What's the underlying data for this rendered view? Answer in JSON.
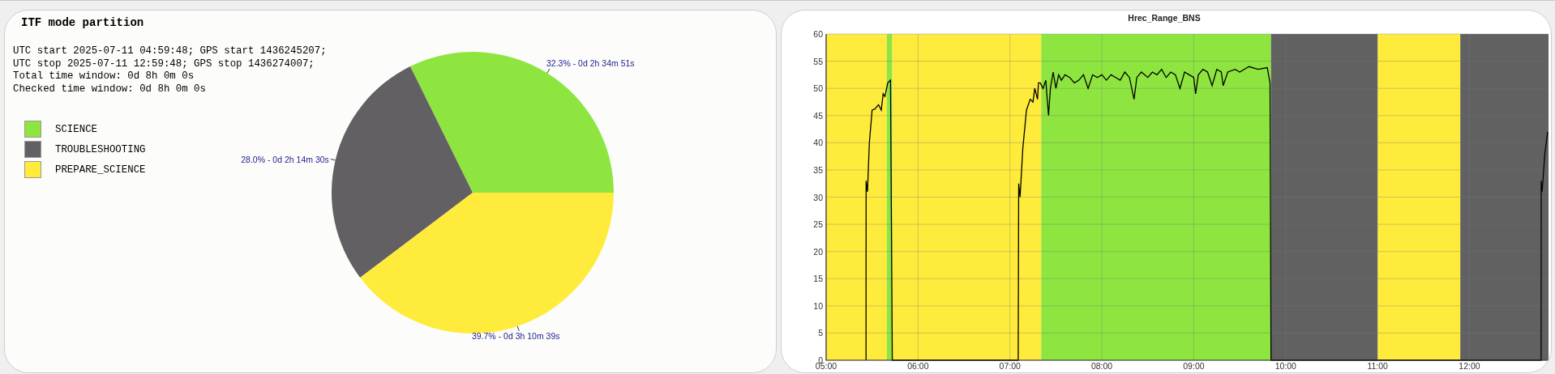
{
  "partition_panel": {
    "title": "ITF mode partition",
    "info_lines": [
      "UTC start 2025-07-11 04:59:48; GPS start 1436245207;",
      "UTC stop 2025-07-11 12:59:48; GPS stop 1436274007;",
      "Total time window: 0d 8h 0m 0s",
      "Checked time window: 0d 8h 0m 0s"
    ],
    "chart_data": {
      "type": "pie",
      "categories": [
        "SCIENCE",
        "TROUBLESHOOTING",
        "PREPARE_SCIENCE"
      ],
      "series": [
        {
          "values": [
            32.3,
            28.0,
            39.7
          ]
        }
      ],
      "colors": [
        "#8ee53f",
        "#636063",
        "#ffeb3b"
      ],
      "value_labels": [
        "32.3% - 0d 2h 34m 51s",
        "28.0% - 0d 2h 14m 30s",
        "39.7% - 0d 3h 10m 39s"
      ]
    }
  },
  "range_panel": {
    "chart_data": {
      "type": "line",
      "title": "Hrec_Range_BNS",
      "x": [
        5.434,
        5.435,
        5.45,
        5.47,
        5.5,
        5.53,
        5.57,
        5.6,
        5.62,
        5.64,
        5.67,
        5.7,
        5.72,
        5.722,
        7.09,
        7.095,
        7.11,
        7.14,
        7.18,
        7.22,
        7.25,
        7.27,
        7.3,
        7.31,
        7.33,
        7.36,
        7.39,
        7.42,
        7.44,
        7.47,
        7.5,
        7.53,
        7.56,
        7.6,
        7.65,
        7.7,
        7.75,
        7.8,
        7.85,
        7.9,
        7.95,
        8.0,
        8.05,
        8.1,
        8.15,
        8.2,
        8.25,
        8.3,
        8.35,
        8.38,
        8.43,
        8.5,
        8.55,
        8.6,
        8.65,
        8.7,
        8.75,
        8.8,
        8.85,
        8.9,
        8.95,
        9.0,
        9.02,
        9.05,
        9.1,
        9.15,
        9.2,
        9.25,
        9.3,
        9.32,
        9.37,
        9.45,
        9.5,
        9.6,
        9.7,
        9.8,
        9.83,
        9.84,
        12.78,
        12.781,
        12.79,
        12.82,
        12.85
      ],
      "series": [
        {
          "color": "#000000",
          "values": [
            0,
            33,
            31,
            40,
            46,
            46.2,
            47,
            46,
            49,
            48.5,
            51,
            51.5,
            0,
            0,
            0,
            32.5,
            30,
            39,
            46,
            48,
            47.5,
            50,
            48,
            51,
            51,
            50,
            51.5,
            45,
            50,
            53,
            50,
            52.5,
            51.5,
            52.5,
            52,
            51,
            51.5,
            52.5,
            50,
            52.5,
            52,
            52.5,
            51.5,
            52.5,
            52,
            51.5,
            53,
            52,
            48,
            52,
            53,
            52,
            53,
            52.5,
            53.5,
            52,
            53,
            52.5,
            50,
            53,
            52.5,
            52,
            49,
            52.5,
            53.5,
            53,
            50.5,
            53.5,
            53,
            50.5,
            53,
            53.5,
            53,
            54,
            53.5,
            53.8,
            51,
            0,
            0,
            33,
            31,
            38,
            42
          ]
        }
      ],
      "xlim": [
        5,
        12.86
      ],
      "ylim": [
        0,
        60
      ],
      "grid": true,
      "xticks": [
        {
          "value": 5,
          "label": "05:00"
        },
        {
          "value": 6,
          "label": "06:00"
        },
        {
          "value": 7,
          "label": "07:00"
        },
        {
          "value": 8,
          "label": "08:00"
        },
        {
          "value": 9,
          "label": "09:00"
        },
        {
          "value": 10,
          "label": "10:00"
        },
        {
          "value": 11,
          "label": "11:00"
        },
        {
          "value": 12,
          "label": "12:00"
        }
      ],
      "yticks": [
        0,
        5,
        10,
        15,
        20,
        25,
        30,
        35,
        40,
        45,
        50,
        55,
        60
      ],
      "bands": [
        {
          "axis": "x",
          "from": 5,
          "to": 5.66,
          "color": "#ffeb3b"
        },
        {
          "axis": "x",
          "from": 5.66,
          "to": 5.72,
          "color": "#8ee53f"
        },
        {
          "axis": "x",
          "from": 5.72,
          "to": 7.34,
          "color": "#ffeb3b"
        },
        {
          "axis": "x",
          "from": 7.34,
          "to": 9.84,
          "color": "#8ee53f"
        },
        {
          "axis": "x",
          "from": 9.84,
          "to": 11.0,
          "color": "#616161"
        },
        {
          "axis": "x",
          "from": 11.0,
          "to": 11.9,
          "color": "#ffeb3b"
        },
        {
          "axis": "x",
          "from": 11.9,
          "to": 12.86,
          "color": "#616161"
        }
      ]
    }
  }
}
